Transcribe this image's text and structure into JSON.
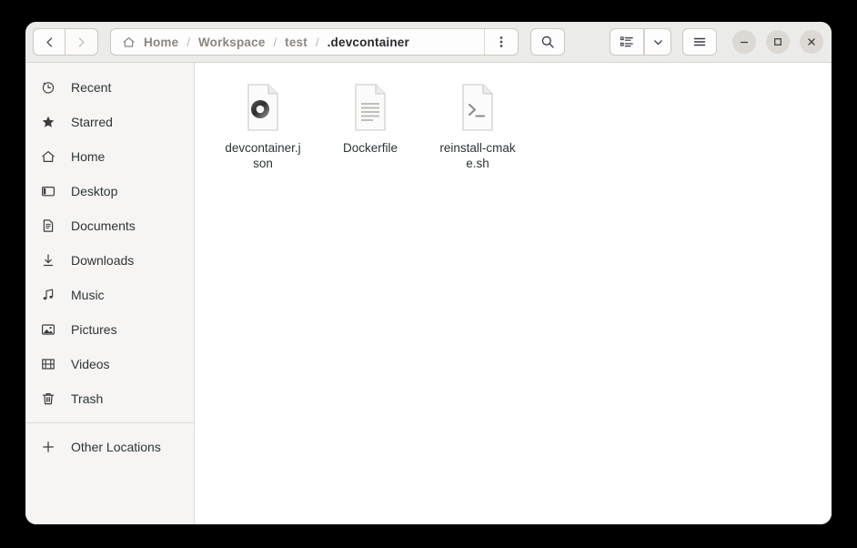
{
  "window": {
    "title": ".devcontainer",
    "controls": {
      "minimize_label": "–",
      "maximize_label": "□",
      "close_label": "×"
    }
  },
  "header": {
    "back_label": "‹",
    "forward_label": "›",
    "back_icon": "chevron-left-icon",
    "forward_icon": "chevron-right-icon",
    "home_icon": "home-icon",
    "dots_icon": "view-more-icon",
    "search_icon": "search-icon",
    "list_view_icon": "list-view-icon",
    "chevron_down_icon": "chevron-down-icon",
    "hamburger_icon": "main-menu-icon",
    "breadcrumb": [
      {
        "label": "Home",
        "current": false
      },
      {
        "label": "Workspace",
        "current": false
      },
      {
        "label": "test",
        "current": false
      },
      {
        "label": ".devcontainer",
        "current": true
      }
    ],
    "separator": "/"
  },
  "sidebar": {
    "items": [
      {
        "label": "Recent",
        "icon": "clock-icon"
      },
      {
        "label": "Starred",
        "icon": "star-icon"
      },
      {
        "label": "Home",
        "icon": "home-icon"
      },
      {
        "label": "Desktop",
        "icon": "desktop-icon"
      },
      {
        "label": "Documents",
        "icon": "document-icon"
      },
      {
        "label": "Downloads",
        "icon": "download-icon"
      },
      {
        "label": "Music",
        "icon": "music-note-icon"
      },
      {
        "label": "Pictures",
        "icon": "picture-icon"
      },
      {
        "label": "Videos",
        "icon": "film-icon"
      },
      {
        "label": "Trash",
        "icon": "trash-icon"
      }
    ],
    "other_locations": {
      "label": "Other Locations",
      "icon": "plus-icon"
    }
  },
  "files": [
    {
      "name": "devcontainer.json",
      "icon": "json-file-icon",
      "selected": false
    },
    {
      "name": "Dockerfile",
      "icon": "text-file-icon",
      "selected": false
    },
    {
      "name": "reinstall-cmake.sh",
      "icon": "shell-script-file-icon",
      "selected": false
    }
  ],
  "colors": {
    "headerbar": "#ebebe9",
    "sidebar": "#f6f5f4",
    "content": "#ffffff",
    "text": "#2e3436",
    "muted_text": "#8b8680",
    "border": "#cdc7c2",
    "page_background": "#000000"
  }
}
